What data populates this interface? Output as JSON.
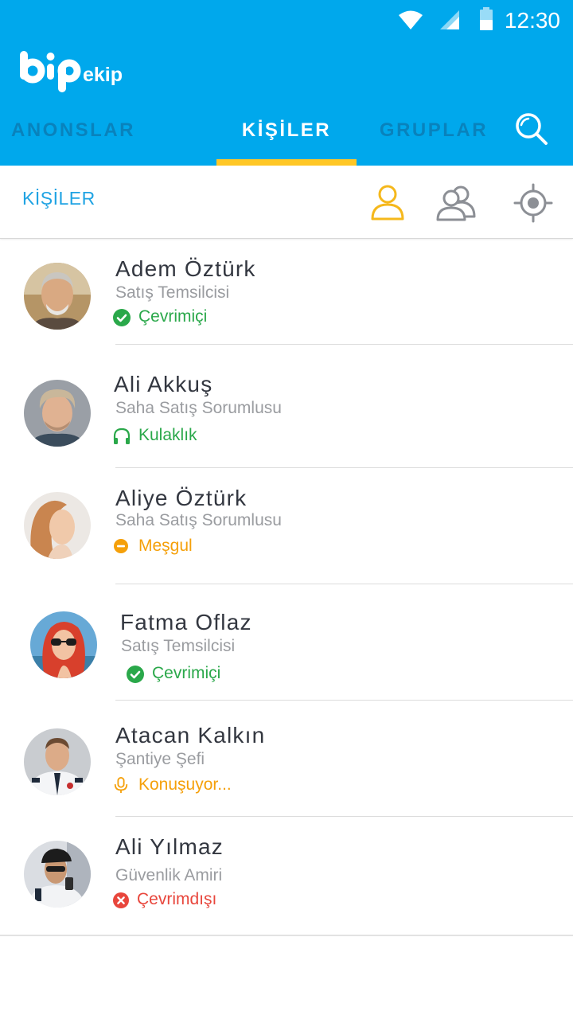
{
  "status_bar": {
    "time": "12:30"
  },
  "brand": {
    "logo_text": "bip",
    "sub_text": "ekip"
  },
  "tabs": [
    {
      "label": "ANONSLAR",
      "active": false
    },
    {
      "label": "KİŞİLER",
      "active": true
    },
    {
      "label": "GRUPLAR",
      "active": false
    }
  ],
  "subheader": {
    "title": "KİŞİLER"
  },
  "icons": {
    "search": "search-icon",
    "single_contact": "person-icon",
    "group": "group-icon",
    "location": "locate-icon"
  },
  "colors": {
    "primary": "#00a8ec",
    "tab_indicator": "#ffc726",
    "online": "#2aa84a",
    "busy": "#f5a00a",
    "offline": "#e8463c"
  },
  "contacts": [
    {
      "name": "Adem Öztürk",
      "role": "Satış Temsilcisi",
      "status": "Çevrimiçi",
      "status_type": "online"
    },
    {
      "name": "Ali Akkuş",
      "role": "Saha Satış Sorumlusu",
      "status": "Kulaklık",
      "status_type": "headset"
    },
    {
      "name": "Aliye Öztürk",
      "role": "Saha Satış Sorumlusu",
      "status": "Meşgul",
      "status_type": "busy"
    },
    {
      "name": "Fatma Oflaz",
      "role": "Satış Temsilcisi",
      "status": "Çevrimiçi",
      "status_type": "online"
    },
    {
      "name": "Atacan Kalkın",
      "role": "Şantiye Şefi",
      "status": "Konuşuyor...",
      "status_type": "talking"
    },
    {
      "name": "Ali Yılmaz",
      "role": "Güvenlik Amiri",
      "status": "Çevrimdışı",
      "status_type": "offline"
    }
  ]
}
